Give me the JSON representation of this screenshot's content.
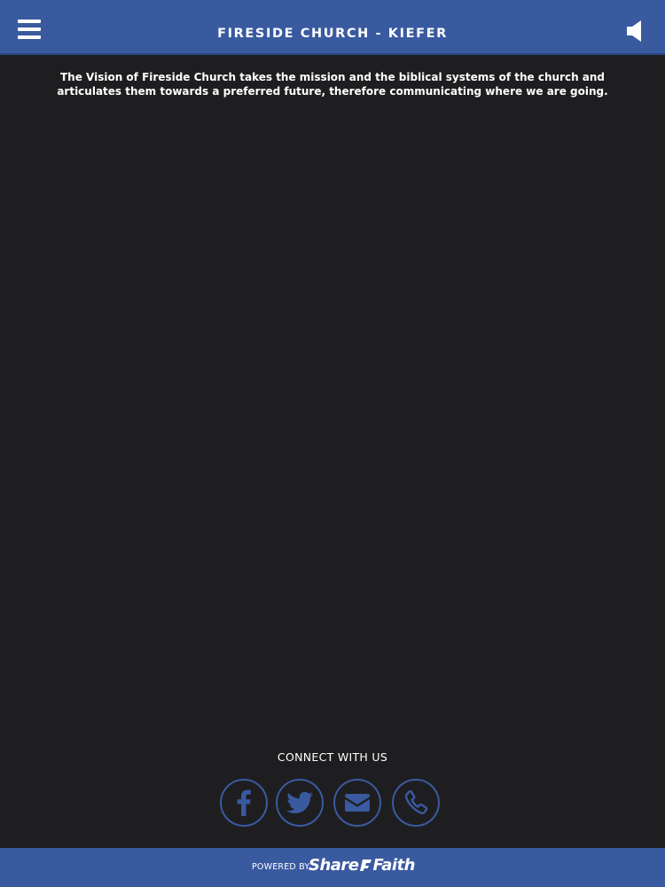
{
  "header": {
    "title": "FIRESIDE CHURCH - KIEFER",
    "menu_icon": "hamburger-menu-icon",
    "speaker_icon": "speaker-icon"
  },
  "main": {
    "vision_text": "The Vision of Fireside Church takes the mission and the biblical systems of the church and articulates them towards a preferred future, therefore communicating where we are going."
  },
  "connect": {
    "title": "CONNECT WITH US",
    "social": [
      {
        "name": "facebook",
        "icon": "facebook-icon"
      },
      {
        "name": "twitter",
        "icon": "twitter-icon"
      },
      {
        "name": "email",
        "icon": "envelope-icon"
      },
      {
        "name": "phone",
        "icon": "phone-icon"
      }
    ]
  },
  "footer": {
    "powered_by": "POWERED BY",
    "brand_left": "Share",
    "brand_right": "Faith"
  },
  "colors": {
    "header_bg": "#3a5aa0",
    "page_bg": "#1e1e20",
    "accent": "#3a5aa0",
    "text": "#ffffff"
  }
}
